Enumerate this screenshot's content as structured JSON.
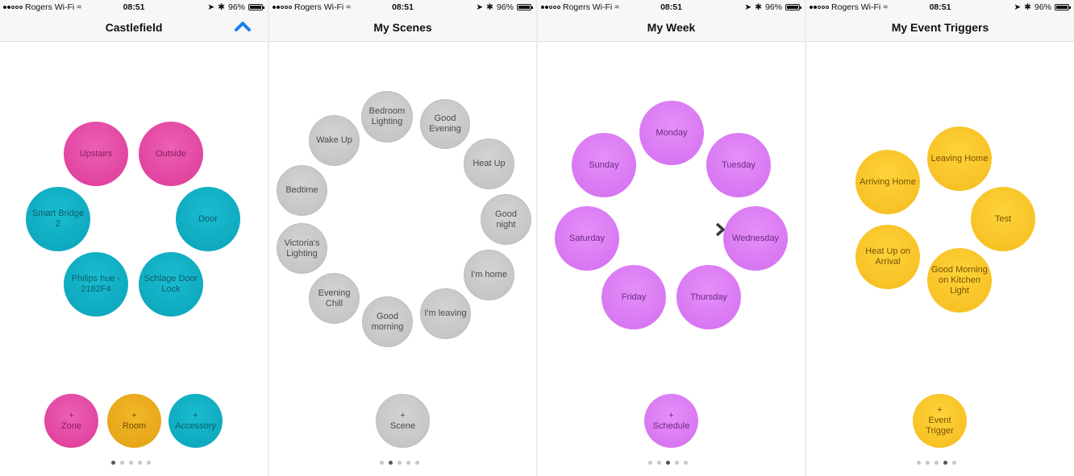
{
  "status": {
    "carrier": "Rogers Wi-Fi",
    "time": "08:51",
    "battery": "96%"
  },
  "screens": [
    {
      "title": "Castlefield",
      "zones": [
        "Upstairs",
        "Outside",
        "Smart Bridge 2",
        "Door",
        "Philips hue - 2182F4",
        "Schlage Door Lock"
      ],
      "actions": [
        "+\nZone",
        "+\nRoom",
        "+\nAccessory"
      ]
    },
    {
      "title": "My Scenes",
      "scenes": [
        "Bedroom Lighting",
        "Good Evening",
        "Wake Up",
        "Heat Up",
        "Bedtime",
        "Good night",
        "Victoria's Lighting",
        "I'm home",
        "Evening Chill",
        "I'm leaving",
        "Good morning"
      ],
      "actions": [
        "+\nScene"
      ]
    },
    {
      "title": "My Week",
      "days": [
        "Monday",
        "Sunday",
        "Tuesday",
        "Saturday",
        "Wednesday",
        "Friday",
        "Thursday"
      ],
      "actions": [
        "+\nSchedule"
      ]
    },
    {
      "title": "My Event Triggers",
      "triggers": [
        "Leaving Home",
        "Arriving Home",
        "Test",
        "Heat Up on Arrival",
        "Good Morning on Kitchen Light"
      ],
      "actions": [
        "+\nEvent Trigger"
      ]
    }
  ],
  "colors": {
    "pink": "#e04aa5",
    "teal": "#10aec3",
    "gray": "#c9c9c9",
    "purple": "#dc7ef5",
    "yellow": "#f9c82c",
    "gold": "#eaab1c",
    "accent": "#1a7ef0"
  },
  "page_indicator": {
    "count": 5,
    "active_by_screen": [
      0,
      1,
      2,
      3
    ]
  }
}
